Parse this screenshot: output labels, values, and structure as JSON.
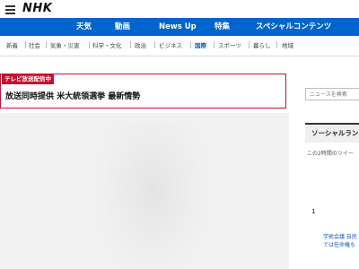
{
  "header": {
    "logo": "NHK"
  },
  "nav": {
    "items": [
      "天気",
      "動画",
      "News Up",
      "特集",
      "スペシャルコンテンツ"
    ]
  },
  "categories": {
    "items": [
      "新着",
      "社会",
      "気象・災害",
      "科学・文化",
      "政治",
      "ビジネス",
      "国際",
      "スポーツ",
      "暮らし",
      "地域"
    ],
    "active": "国際"
  },
  "live": {
    "badge": "テレビ放送配信中",
    "title": "放送同時提供 米大統領選挙 最新情勢"
  },
  "search": {
    "placeholder": "ニュースを検索"
  },
  "social": {
    "title": "ソーシャルラン",
    "subtitle": "この2時間のツイー",
    "rank": "1",
    "tweet_line1": "学術会議 自民",
    "tweet_line2": "では任命権も"
  },
  "colors": {
    "nav_bg": "#0064ce",
    "live_red": "#c8102e",
    "active_cat": "#0a63c7"
  }
}
